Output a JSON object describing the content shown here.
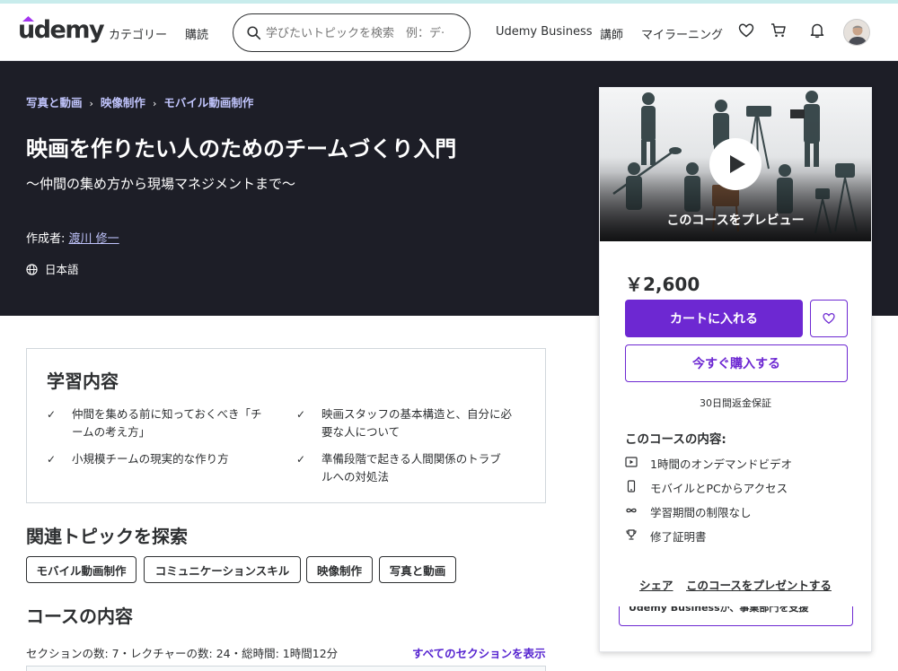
{
  "header": {
    "logo": "udemy",
    "categories": "カテゴリー",
    "subscribe": "購読",
    "search_placeholder": "学びたいトピックを検索　例：デ·",
    "business": "Udemy Business",
    "instructor": "講師",
    "my_learning": "マイラーニング"
  },
  "hero": {
    "breadcrumb": [
      "写真と動画",
      "映像制作",
      "モバイル動画制作"
    ],
    "title": "映画を作りたい人のためのチームづくり入門",
    "subtitle": "〜仲間の集め方から現場マネジメントまで〜",
    "author_label": "作成者:",
    "author_name": "渡川 修一",
    "language": "日本語"
  },
  "learn": {
    "title": "学習内容",
    "items": [
      "仲間を集める前に知っておくべき「チームの考え方」",
      "映画スタッフの基本構造と、自分に必要な人について",
      "小規模チームの現実的な作り方",
      "準備段階で起きる人間関係のトラブルへの対処法"
    ]
  },
  "topics": {
    "title": "関連トピックを探索",
    "items": [
      "モバイル動画制作",
      "コミュニケーションスキル",
      "映像制作",
      "写真と動画"
    ]
  },
  "content": {
    "title": "コースの内容",
    "meta": "セクションの数: 7・レクチャーの数: 24・総時間: 1時間12分",
    "show_all": "すべてのセクションを表示"
  },
  "card": {
    "preview_label": "このコースをプレビュー",
    "price": "￥2,600",
    "add_to_cart": "カートに入れる",
    "buy_now": "今すぐ購入する",
    "guarantee": "30日間返金保証",
    "includes_title": "このコースの内容:",
    "includes": [
      {
        "icon": "video-icon",
        "label": "1時間のオンデマンドビデオ"
      },
      {
        "icon": "mobile-icon",
        "label": "モバイルとPCからアクセス"
      },
      {
        "icon": "infinity-icon",
        "label": "学習期間の制限なし"
      },
      {
        "icon": "trophy-icon",
        "label": "修了証明書"
      }
    ],
    "share": "シェア",
    "gift": "このコースをプレゼントする",
    "business_strip": "Udemy Businessが、事業部門を支援"
  },
  "colors": {
    "accent": "#6d28d2",
    "hero_bg": "#1d1e27",
    "breadcrumb": "#c0c4fc"
  }
}
